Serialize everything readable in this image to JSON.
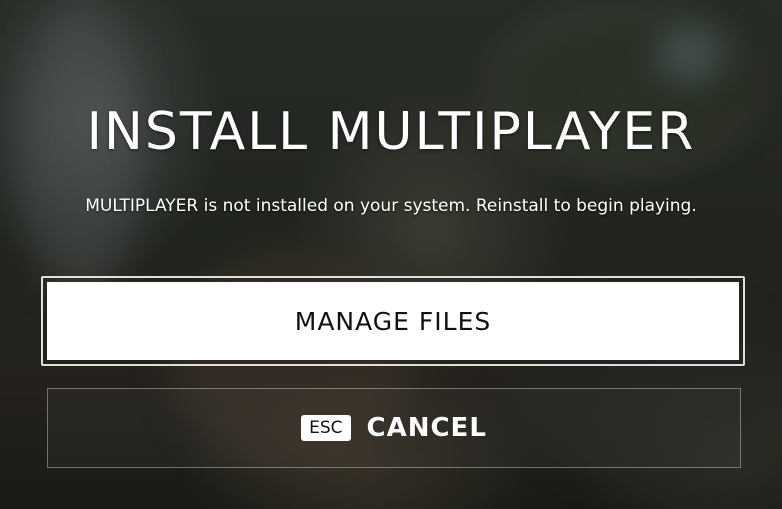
{
  "dialog": {
    "title": "INSTALL MULTIPLAYER",
    "message": "MULTIPLAYER is not installed on your system. Reinstall to begin playing."
  },
  "actions": {
    "manage_label": "MANAGE FILES",
    "cancel_key": "ESC",
    "cancel_label": "CANCEL"
  },
  "colors": {
    "primary_button_bg": "#ffffff",
    "primary_button_text": "#111111",
    "text": "#ffffff"
  }
}
